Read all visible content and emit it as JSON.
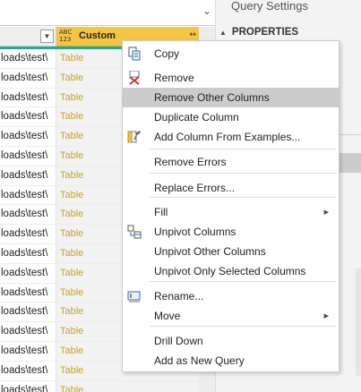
{
  "grid": {
    "header": {
      "custom_type_top": "ABC",
      "custom_type_bottom": "123",
      "custom_name": "Custom",
      "filter_glyph": "▼",
      "expand_glyph": "↔"
    },
    "rows": [
      {
        "path": "loads\\test\\",
        "value": "Table"
      },
      {
        "path": "loads\\test\\",
        "value": "Table"
      },
      {
        "path": "loads\\test\\",
        "value": "Table"
      },
      {
        "path": "loads\\test\\",
        "value": "Table"
      },
      {
        "path": "loads\\test\\",
        "value": "Table"
      },
      {
        "path": "loads\\test\\",
        "value": "Table"
      },
      {
        "path": "loads\\test\\",
        "value": "Table"
      },
      {
        "path": "loads\\test\\",
        "value": "Table"
      },
      {
        "path": "loads\\test\\",
        "value": "Table"
      },
      {
        "path": "loads\\test\\",
        "value": "Table"
      },
      {
        "path": "loads\\test\\",
        "value": "Table"
      },
      {
        "path": "loads\\test\\",
        "value": "Table"
      },
      {
        "path": "loads\\test\\",
        "value": "Table"
      },
      {
        "path": "loads\\test\\",
        "value": "Table"
      },
      {
        "path": "loads\\test\\",
        "value": "Table"
      },
      {
        "path": "loads\\test\\",
        "value": "Table"
      },
      {
        "path": "loads\\test\\",
        "value": "Table"
      },
      {
        "path": "loads\\test\\",
        "value": "Table"
      }
    ]
  },
  "pane": {
    "title": "Query Settings",
    "properties_label": "PROPERTIES",
    "collapse_glyph": "▲",
    "chevron_glyph": "⌄"
  },
  "menu": {
    "items": [
      {
        "label": "Copy",
        "icon": "copy-icon"
      },
      {
        "label": "Remove",
        "icon": "remove-icon"
      },
      {
        "label": "Remove Other Columns",
        "highlighted": true
      },
      {
        "label": "Duplicate Column"
      },
      {
        "label": "Add Column From Examples...",
        "icon": "add-column-examples-icon"
      },
      {
        "label": "Remove Errors"
      },
      {
        "label": "Replace Errors..."
      },
      {
        "label": "Fill",
        "submenu": true
      },
      {
        "label": "Unpivot Columns",
        "icon": "unpivot-icon"
      },
      {
        "label": "Unpivot Other Columns"
      },
      {
        "label": "Unpivot Only Selected Columns"
      },
      {
        "label": "Rename...",
        "icon": "rename-icon"
      },
      {
        "label": "Move",
        "submenu": true
      },
      {
        "label": "Drill Down"
      },
      {
        "label": "Add as New Query"
      }
    ],
    "submenu_glyph": "▶"
  },
  "colors": {
    "column_header": "#f4c542",
    "selection_bar": "#1fa89a",
    "table_value": "#c9a227",
    "menu_highlight": "#cccccc"
  }
}
